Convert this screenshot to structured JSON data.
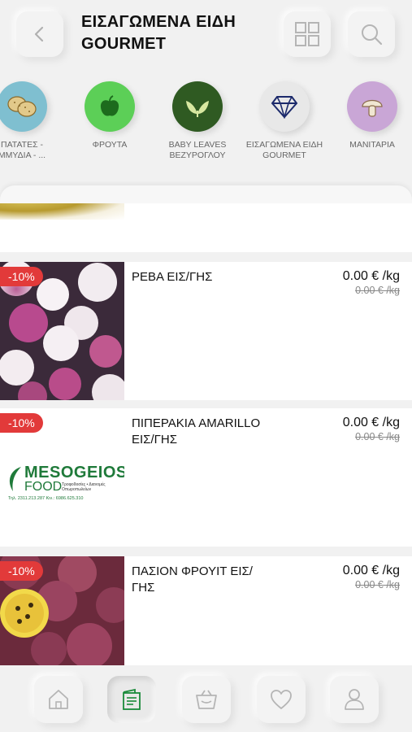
{
  "header": {
    "title": "ΕΙΣΑΓΩΜΕΝΑ ΕΙΔΗ GOURMET"
  },
  "categories": [
    {
      "label": "ΠΑΤΑΤΕΣ - ΟΣΠΡΙΑ - ΑΜΜΥΔΙΑ - ...",
      "display": "ΠΑΤΑΤΕΣ -\nΜΜΥΔΙΑ - ...",
      "icon": "potato-icon",
      "color": "#7fbfd0"
    },
    {
      "label": "ΦΡΟΥΤΑ",
      "icon": "apple-icon",
      "color": "#5ccf57"
    },
    {
      "label": "BABY LEAVES ΒΕΖΥΡΟΓΛΟΥ",
      "icon": "leaves-icon",
      "color": "#2f5a22"
    },
    {
      "label": "ΕΙΣΑΓΩΜΕΝΑ ΕΙΔΗ GOURMET",
      "icon": "diamond-icon",
      "color": "#e8e8e8"
    },
    {
      "label": "ΜΑΝΙΤΑΡΙΑ",
      "icon": "mushroom-icon",
      "color": "#c9a6d6"
    }
  ],
  "products": [
    {
      "badge": "-10%",
      "name": "ΡΕΒΑ ΕΙΣ/ΓΗΣ",
      "price": "0.00 € /kg",
      "old_price": "0.00 € /kg"
    },
    {
      "badge": "-10%",
      "name": "ΠΙΠΕΡΑΚΙΑ AMARILLO ΕΙΣ/ΓΗΣ",
      "price": "0.00 € /kg",
      "old_price": "0.00 € /kg",
      "logo": {
        "line1": "MESOGEIOS",
        "line2": "FOOD",
        "tagline": "Τροφοδοσίες • Διανομές Οπωροπωλείων",
        "contact": "Τηλ. 2311.213.287 Κιν.: 6986.625.310"
      }
    },
    {
      "badge": "-10%",
      "name": "ΠΑΣΙΟΝ ΦΡΟΥΙΤ ΕΙΣ/ ΓΗΣ",
      "price": "0.00 € /kg",
      "old_price": "0.00 € /kg"
    }
  ],
  "bottom_nav": [
    {
      "name": "home",
      "icon": "home-icon",
      "active": false
    },
    {
      "name": "catalog",
      "icon": "catalog-icon",
      "active": true
    },
    {
      "name": "basket",
      "icon": "basket-icon",
      "active": false
    },
    {
      "name": "favorites",
      "icon": "heart-icon",
      "active": false
    },
    {
      "name": "profile",
      "icon": "user-icon",
      "active": false
    }
  ],
  "colors": {
    "accent": "#1a8a3a",
    "badge": "#e23a3a",
    "brand_green": "#1f7a3a"
  }
}
